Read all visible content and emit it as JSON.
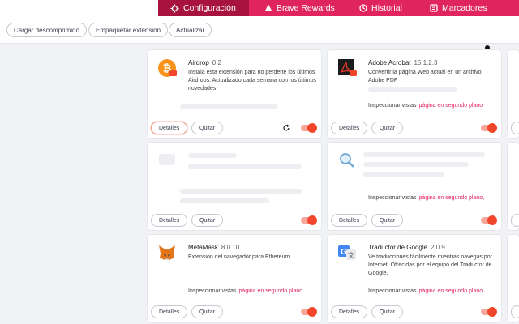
{
  "tabs": [
    {
      "label": "Configuración",
      "icon": "gear-icon",
      "active": true
    },
    {
      "label": "Brave Rewards",
      "icon": "rewards-triangle-icon"
    },
    {
      "label": "Historial",
      "icon": "history-clock-icon"
    },
    {
      "label": "Marcadores",
      "icon": "bookmarks-icon"
    }
  ],
  "toolbar": {
    "load_unpacked": "Cargar descomprimido",
    "pack_extension": "Empaquetar extensión",
    "update": "Actualizar"
  },
  "common": {
    "details": "Detalles",
    "remove": "Quitar",
    "inspect_views": "Inspeccionar vistas",
    "background_page": "página en segundo plano"
  },
  "extensions": [
    {
      "name": "Airdrop",
      "version": "0.2",
      "description": "Instala esta extensión para no perderte los últimos Airdrops. Actualizado cada semana con los últimos novedades.",
      "enabled": true
    },
    {
      "name": "Adobe Acrobat",
      "version": "15.1.2.3",
      "description": "Convertir la página Web actual en un archivo Adobe PDF",
      "inspect_suffix": "",
      "enabled": true
    },
    {
      "name": "",
      "version": "",
      "description": "",
      "enabled": true
    },
    {
      "name": "",
      "version": "",
      "description": "",
      "inspect_suffix": ",",
      "enabled": true
    },
    {
      "name": "MetaMask",
      "version": "8.0.10",
      "description": "Extensión del navegador para Ethereum",
      "enabled": true
    },
    {
      "name": "Traductor de Google",
      "version": "2.0.9",
      "description": "Ve traducciones fácilmente mientras navegas por Internet. Ofrecidas por el equipo del Traductor de Google.",
      "enabled": true
    }
  ],
  "colors": {
    "accent": "#e0245e",
    "active_tab": "#a8123e",
    "toggle_on": "#f1462c"
  }
}
